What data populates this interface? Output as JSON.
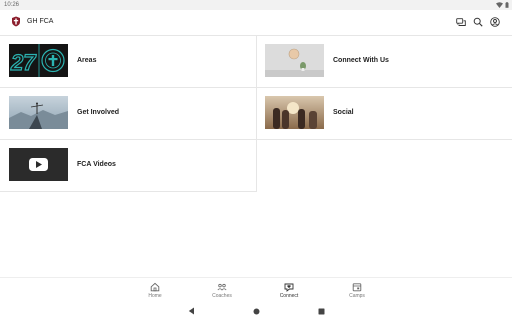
{
  "status_bar": {
    "time": "10:26"
  },
  "app_bar": {
    "title": "GH FCA",
    "actions": [
      "chat-icon",
      "search-icon",
      "account-icon"
    ]
  },
  "tiles": [
    {
      "label": "Areas",
      "image": "areas-logo-image"
    },
    {
      "label": "Connect With Us",
      "image": "wall-clock-plant-image"
    },
    {
      "label": "Get Involved",
      "image": "person-on-mountain-image"
    },
    {
      "label": "Social",
      "image": "group-sunset-image"
    },
    {
      "label": "FCA Videos",
      "image": "youtube-play-image"
    }
  ],
  "bottom_nav": {
    "items": [
      {
        "label": "Home",
        "icon": "home-icon"
      },
      {
        "label": "Coaches",
        "icon": "people-icon"
      },
      {
        "label": "Connect",
        "icon": "connect-icon",
        "active": true
      },
      {
        "label": "Camps",
        "icon": "calendar-icon"
      }
    ]
  },
  "system_nav": [
    "back-icon",
    "home-circle-icon",
    "recents-icon"
  ],
  "colors": {
    "accent_dark": "#1a1a1a",
    "teal": "#2bb3b1",
    "divider": "#e6e6e6"
  }
}
